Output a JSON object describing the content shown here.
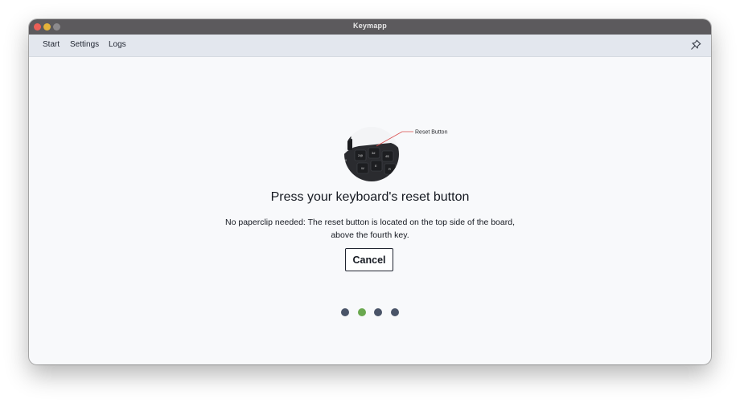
{
  "window": {
    "title": "Keymapp"
  },
  "menu": {
    "items": [
      "Start",
      "Settings",
      "Logs"
    ]
  },
  "icons": {
    "pin": "pin-icon"
  },
  "illustration": {
    "callout": "Reset Button",
    "key_labels": [
      "1!",
      "2@",
      "3#",
      "4$",
      "W",
      "E",
      "R"
    ]
  },
  "main": {
    "heading": "Press your keyboard's reset button",
    "description_line1": "No paperclip needed: The reset button is located on the top side of the board,",
    "description_line2": "above the fourth key.",
    "cancel_label": "Cancel"
  },
  "progress": {
    "total_steps": 4,
    "active_step": 2,
    "colors": {
      "inactive": "#4a5468",
      "active": "#6aa84f"
    }
  }
}
